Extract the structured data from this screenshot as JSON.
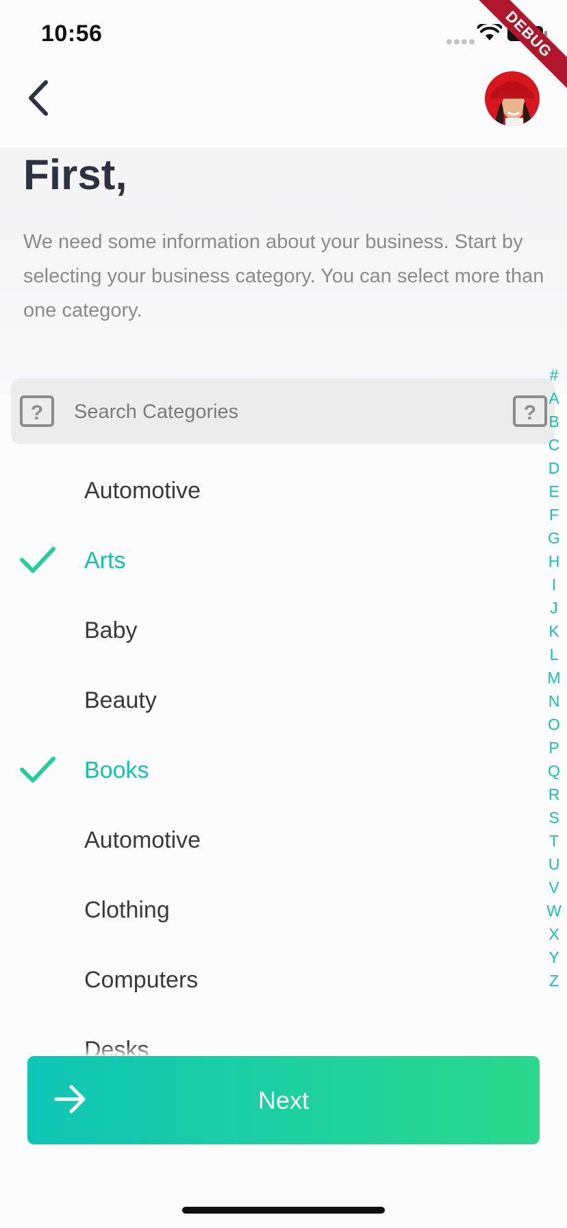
{
  "status_bar": {
    "time": "10:56"
  },
  "debug_banner": "DEBUG",
  "header": {
    "title": "First,",
    "description": "We need some information about your business. Start by selecting your business category. You can select more than one category."
  },
  "search": {
    "placeholder": "Search Categories",
    "value": ""
  },
  "categories": [
    {
      "label": "Automotive",
      "selected": false
    },
    {
      "label": "Arts",
      "selected": true
    },
    {
      "label": "Baby",
      "selected": false
    },
    {
      "label": "Beauty",
      "selected": false
    },
    {
      "label": "Books",
      "selected": true
    },
    {
      "label": "Automotive",
      "selected": false
    },
    {
      "label": "Clothing",
      "selected": false
    },
    {
      "label": "Computers",
      "selected": false
    },
    {
      "label": "Desks",
      "selected": false
    }
  ],
  "alphabet_index": [
    "#",
    "A",
    "B",
    "C",
    "D",
    "E",
    "F",
    "G",
    "H",
    "I",
    "J",
    "K",
    "L",
    "M",
    "N",
    "O",
    "P",
    "Q",
    "R",
    "S",
    "T",
    "U",
    "V",
    "W",
    "X",
    "Y",
    "Z"
  ],
  "next_button": {
    "label": "Next"
  },
  "colors": {
    "accent": "#12c1b0",
    "gradient_start": "#0fc6b6",
    "gradient_end": "#2ad98c",
    "title": "#2e3140",
    "debug_banner": "#b0172c"
  },
  "icons": {
    "back": "chevron-left-icon",
    "avatar": "user-avatar",
    "search_left": "question-box-icon",
    "search_right": "question-box-icon",
    "check": "check-icon",
    "next": "arrow-right-icon"
  }
}
